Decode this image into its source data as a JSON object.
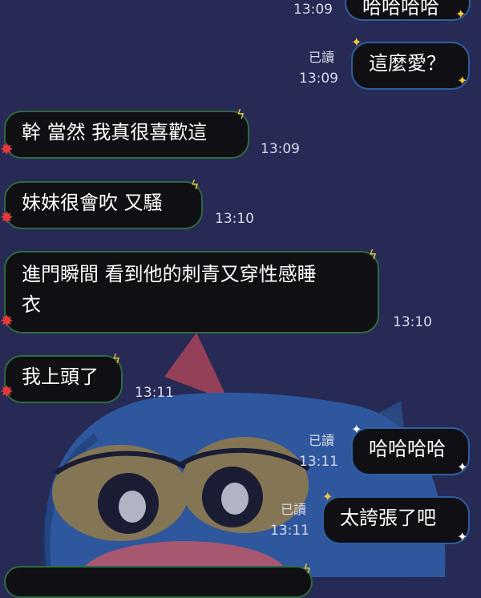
{
  "chat": {
    "messages": [
      {
        "id": "m0",
        "dir": "out",
        "text": "哈哈哈哈",
        "time": "13:09"
      },
      {
        "id": "m1",
        "dir": "out",
        "text": "這麼愛？",
        "time": "13:09",
        "read": "已讀"
      },
      {
        "id": "m2",
        "dir": "in",
        "text": "幹 當然 我真很喜歡這",
        "time": "13:09"
      },
      {
        "id": "m3",
        "dir": "in",
        "text": "妹妹很會吹 又騷",
        "time": "13:10"
      },
      {
        "id": "m4",
        "dir": "in",
        "lines": [
          "進門瞬間 看到他的刺青又穿性感睡",
          "衣"
        ],
        "time": "13:10"
      },
      {
        "id": "m5",
        "dir": "in",
        "text": "我上頭了",
        "time": "13:11"
      },
      {
        "id": "m6",
        "dir": "out",
        "text": "哈哈哈哈",
        "time": "13:11",
        "read": "已讀"
      },
      {
        "id": "m7",
        "dir": "out",
        "text": "太誇張了吧",
        "time": "13:11",
        "read": "已讀"
      }
    ]
  },
  "theme": {
    "background": "#262a55",
    "bubble_fill": "#0f0f14",
    "incoming_border": "#2e6b3f",
    "outgoing_border": "#2f5f9e",
    "accent_yellow": "#f2c63c",
    "accent_red": "#e23a3a"
  },
  "icons": [
    "lightning-bolt-icon",
    "red-star-icon",
    "sparkle-icon"
  ]
}
